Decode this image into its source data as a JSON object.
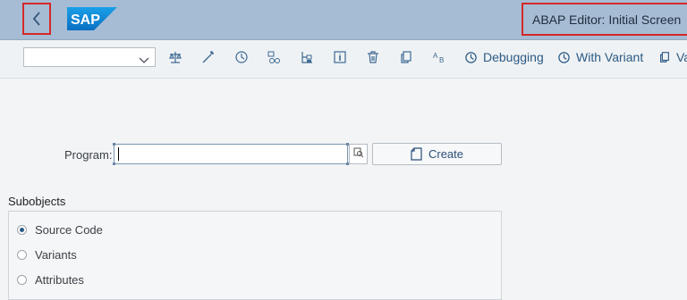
{
  "header": {
    "title": "ABAP Editor: Initial Screen",
    "logo_text": "SAP",
    "back_icon": "chevron-left-icon"
  },
  "toolbar": {
    "dropdown_value": "",
    "icons": [
      "balance-icon",
      "magic-wand-icon",
      "clock-icon",
      "where-used-icon",
      "hierarchy-icon",
      "info-icon",
      "delete-icon",
      "copy-icon",
      "spell-check-icon"
    ],
    "debugging_label": "Debugging",
    "with_variant_label": "With Variant",
    "variants_label": "Va"
  },
  "form": {
    "program_label": "Program:",
    "program_value": "",
    "create_label": "Create"
  },
  "subobjects": {
    "title": "Subobjects",
    "options": [
      {
        "label": "Source Code",
        "selected": true
      },
      {
        "label": "Variants",
        "selected": false
      },
      {
        "label": "Attributes",
        "selected": false
      }
    ]
  },
  "colors": {
    "shell": "#a6bcd4",
    "highlight_border": "#d42828",
    "accent": "#2a5a85"
  }
}
